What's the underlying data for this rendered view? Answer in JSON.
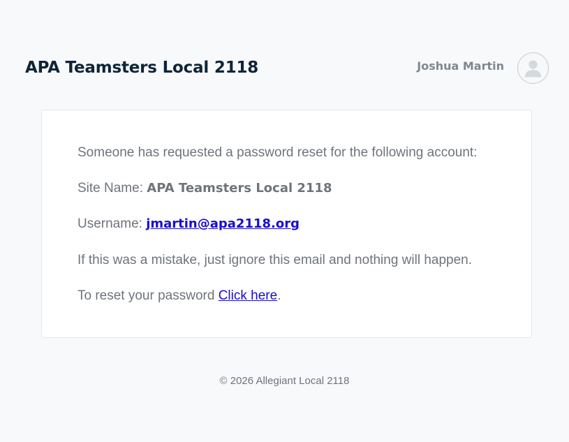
{
  "header": {
    "site_title": "APA Teamsters Local 2118",
    "user_name": "Joshua Martin",
    "avatar_icon": "user-avatar-icon"
  },
  "email": {
    "intro": "Someone has requested a password reset for the following account:",
    "site_name_label": "Site Name:",
    "site_name_value": "APA Teamsters Local 2118",
    "username_label": "Username:",
    "username_value": "jmartin@apa2118.org",
    "mistake_text": "If this was a mistake, just ignore this email and nothing will happen.",
    "reset_prefix": "To reset your password",
    "reset_link_label": "Click here",
    "reset_suffix": "."
  },
  "footer": {
    "copyright": "© 2026 Allegiant Local 2118"
  },
  "colors": {
    "page_background": "#f8f9fb",
    "title": "#0f2438",
    "body_text": "#6e747b",
    "link": "#1a0dcc"
  }
}
